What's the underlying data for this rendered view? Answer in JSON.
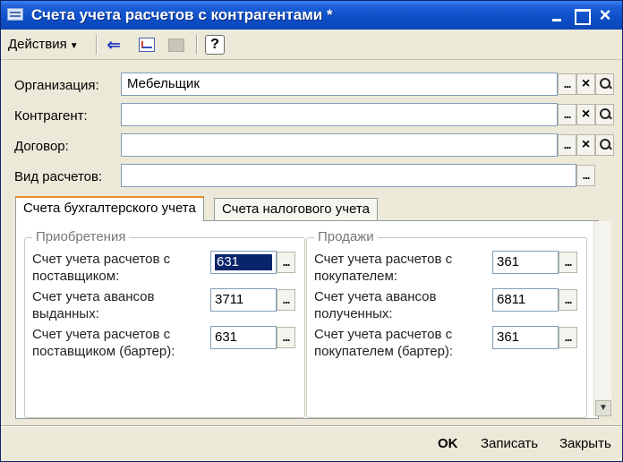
{
  "window": {
    "title": "Счета учета расчетов с контрагентами *"
  },
  "toolbar": {
    "actions_label": "Действия",
    "help_label": "?"
  },
  "fields": {
    "organization": {
      "label": "Организация:",
      "value": "Мебельщик"
    },
    "counterparty": {
      "label": "Контрагент:",
      "value": ""
    },
    "contract": {
      "label": "Договор:",
      "value": ""
    },
    "settlement_type": {
      "label": "Вид расчетов:",
      "value": ""
    }
  },
  "buttons": {
    "select": "...",
    "clear": "×"
  },
  "tabs": [
    {
      "label": "Счета бухгалтерского учета",
      "active": true
    },
    {
      "label": "Счета налогового учета",
      "active": false
    }
  ],
  "purchases": {
    "title": "Приобретения",
    "rows": [
      {
        "label": "Счет учета расчетов с поставщиком:",
        "value": "631"
      },
      {
        "label": "Счет учета авансов выданных:",
        "value": "3711"
      },
      {
        "label": "Счет учета расчетов с поставщиком (бартер):",
        "value": "631"
      }
    ]
  },
  "sales": {
    "title": "Продажи",
    "rows": [
      {
        "label": "Счет учета расчетов с покупателем:",
        "value": "361"
      },
      {
        "label": "Счет учета авансов полученных:",
        "value": "6811"
      },
      {
        "label": "Счет учета расчетов с покупателем (бартер):",
        "value": "361"
      }
    ]
  },
  "footer": {
    "ok": "OK",
    "save": "Записать",
    "close": "Закрыть"
  }
}
